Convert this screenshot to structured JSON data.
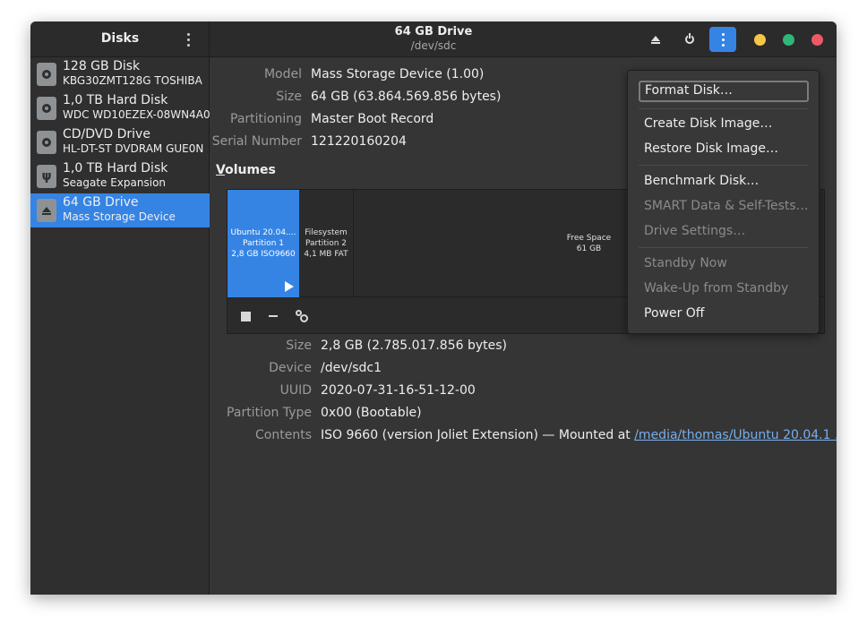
{
  "sidebar": {
    "title": "Disks",
    "disks": [
      {
        "name": "128 GB Disk",
        "subtitle": "KBG30ZMT128G TOSHIBA",
        "icon": "hard-disk-icon"
      },
      {
        "name": "1,0 TB Hard Disk",
        "subtitle": "WDC WD10EZEX-08WN4A0",
        "icon": "hard-disk-icon"
      },
      {
        "name": "CD/DVD Drive",
        "subtitle": "HL-DT-ST DVDRAM GUE0N",
        "icon": "optical-drive-icon"
      },
      {
        "name": "1,0 TB Hard Disk",
        "subtitle": "Seagate Expansion",
        "icon": "usb-drive-icon"
      },
      {
        "name": "64 GB Drive",
        "subtitle": "Mass Storage Device",
        "icon": "removable-drive-icon"
      }
    ]
  },
  "header": {
    "title": "64 GB Drive",
    "subtitle": "/dev/sdc"
  },
  "colors": {
    "accent": "#3584e4",
    "win_minimize": "#f6c744",
    "win_maximize": "#2fb67a",
    "win_close": "#ed5a66"
  },
  "drive_info": {
    "model_label": "Model",
    "model_value": "Mass Storage Device (1.00)",
    "size_label": "Size",
    "size_value": "64 GB (63.864.569.856 bytes)",
    "partitioning_label": "Partitioning",
    "partitioning_value": "Master Boot Record",
    "serial_label": "Serial Number",
    "serial_value": "121220160204"
  },
  "volumes": {
    "title_prefix": "V",
    "title_rest": "olumes",
    "partitions": [
      {
        "line1": "Ubuntu 20.04....",
        "line2": "Partition 1",
        "line3": "2,8 GB ISO9660"
      },
      {
        "line1": "Filesystem",
        "line2": "Partition 2",
        "line3": "4,1 MB FAT"
      },
      {
        "line1": "Free Space",
        "line2": "61 GB"
      }
    ]
  },
  "partition_info": {
    "size_label": "Size",
    "size_value": "2,8 GB (2.785.017.856 bytes)",
    "device_label": "Device",
    "device_value": "/dev/sdc1",
    "uuid_label": "UUID",
    "uuid_value": "2020-07-31-16-51-12-00",
    "type_label": "Partition Type",
    "type_value": "0x00 (Bootable)",
    "contents_label": "Contents",
    "contents_value": "ISO 9660 (version Joliet Extension) — Mounted at ",
    "contents_link": "/media/thomas/Ubuntu 20.04.1 ..."
  },
  "menu": {
    "format_disk": "Format Disk…",
    "create_image": "Create Disk Image…",
    "restore_image": "Restore Disk Image…",
    "benchmark": "Benchmark Disk…",
    "smart": "SMART Data & Self-Tests…",
    "drive_settings": "Drive Settings…",
    "standby": "Standby Now",
    "wakeup": "Wake-Up from Standby",
    "power_off": "Power Off"
  }
}
